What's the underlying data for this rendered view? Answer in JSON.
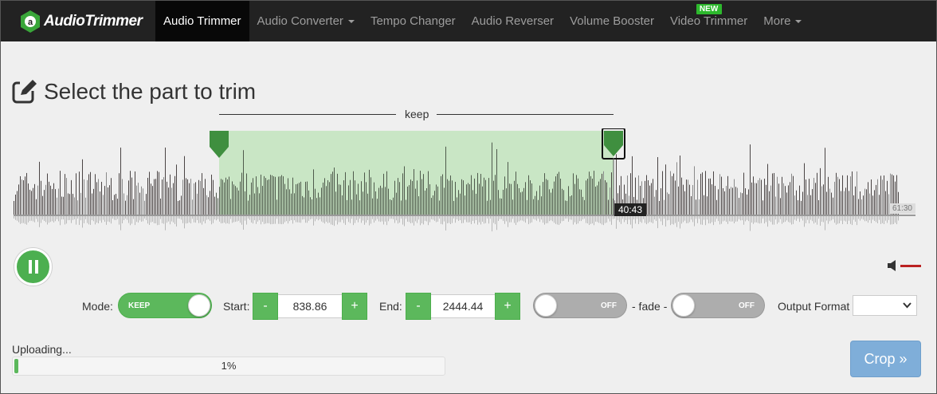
{
  "brand": {
    "name": "AudioTrimmer"
  },
  "nav": {
    "items": [
      {
        "label": "Audio Trimmer",
        "active": true
      },
      {
        "label": "Audio Converter",
        "dropdown": true
      },
      {
        "label": "Tempo Changer"
      },
      {
        "label": "Audio Reverser"
      },
      {
        "label": "Volume Booster"
      },
      {
        "label": "Video Trimmer",
        "badge": "NEW"
      },
      {
        "label": "More",
        "dropdown": true
      }
    ]
  },
  "page": {
    "title": "Select the part to trim",
    "title_icon": "edit-icon"
  },
  "waveform": {
    "keep_label": "keep",
    "current_time": "40:43",
    "end_time": "61:30",
    "selection_fraction": {
      "start": 0.2274,
      "end": 0.6628
    },
    "colors": {
      "wave": "#4a4444",
      "selection": "#c9e6c5",
      "handle": "#3f8f3f"
    }
  },
  "controls": {
    "mode_label": "Mode:",
    "mode_value": "KEEP",
    "start_label": "Start:",
    "start_value": "838.86",
    "end_label": "End:",
    "end_value": "2444.44",
    "minus": "-",
    "plus": "+",
    "fade_in": "OFF",
    "fade_label": "- fade -",
    "fade_out": "OFF",
    "output_format_label": "Output Format",
    "output_format_value": ""
  },
  "upload": {
    "status": "Uploading...",
    "progress_percent": 1,
    "progress_text": "1%"
  },
  "crop_button": "Crop »",
  "accent": {
    "green": "#5cb85c",
    "blue": "#7faed9"
  }
}
